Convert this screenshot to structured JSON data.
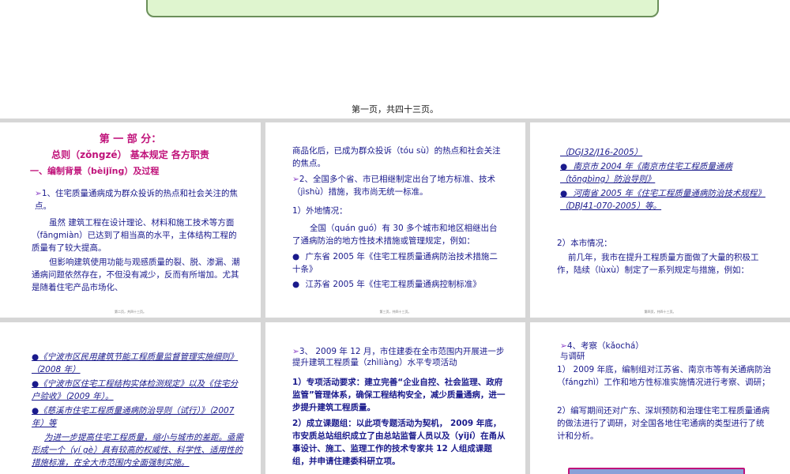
{
  "page_count": "第一页，共四十三页。",
  "slide1": {
    "heading": "第 一 部 分：",
    "subheading": "总则（zǒngzé） 基本规定 各方职责",
    "section": "一、编制背景（bèijǐng）及过程",
    "p1": "1、住宅质量通病成为群众投诉的热点和社会关注的焦点。",
    "p2": "虽然 建筑工程在设计理论、材料和施工技术等方面（fāngmiàn）已达到了相当高的水平，主体结构工程的质量有了较大提高。",
    "p3": "但影响建筑使用功能与观感质量的裂、脱、渗漏、潮通病问题依然存在，不但没有减少，反而有所增加。尤其是随着住宅产品市场化、",
    "footer": "第二页，共四十三页。"
  },
  "slide2": {
    "p1": "商品化后，已成为群众投诉（tóu sù）的热点和社会关注的焦点。",
    "p2": "2、全国多个省、市已相继制定出台了地方标准、技术（jìshù）措施，我市尚无统一标准。",
    "p3": "1）外地情况：",
    "p4": "全国（quán guó）有 30 多个城市和地区相继出台了通病防治的地方性技术措施或管理规定，例如：",
    "b1": "广东省 2005 年《住宅工程质量通病防治技术措施二十条》",
    "b2": "江苏省 2005 年《住宅工程质量通病控制标准》",
    "footer": "第三页，共四十三页。"
  },
  "slide3": {
    "l1": "（DGJ32/J16-2005）",
    "b1": "南京市 2004 年《南京市住宅工程质量通病（tōngbìng）防治导则》",
    "b2": "河南省 2005 年《住宅工程质量通病防治技术规程》（DBJ41-070-2005）等。",
    "p1": "2）本市情况：",
    "p2": "前几年，我市在提升工程质量方面做了大量的积极工作，陆续（lùxù）制定了一系列规定与措施，例如：",
    "footer": "第四页，共四十三页。"
  },
  "slide4": {
    "b1": "《宁波市区民用建筑节能工程质量监督管理实施细则》（2008 年）",
    "b2": "《宁波市区住宅工程结构实体检测规定》以及《住宅分户验收》（2009 年）。",
    "b3": "《慈溪市住宅工程质量通病防治导则（试行）》（2007 年）等",
    "p1": "为进一步提高住宅工程质量，缩小与城市的差距。亟需形成一个（yí gè）具有较高的权威性、科学性、适用性的措施标准，在全大市范围内全面强制实施。"
  },
  "slide5": {
    "p1": "3、 2009 年 12 月，市住建委在全市范围内开展进一步提升建筑工程质量（zhìliàng）水平专项活动",
    "p2": "1）专项活动要求：建立完善“企业自控、社会监理、政府监管”管理体系，确保工程结构安全，减少质量通病，进一步提升建筑工程质量。",
    "p3": "2）成立课题组：以此项专题活动为契机， 2009 年底，市安质总站组织成立了由总站监督人员以及（yǐjí）在甬从事设计、施工、监理工作的技术专家共 12 人组成课题组，并申请住建委科研立项。"
  },
  "slide6": {
    "p1": "4、考察（kǎochá）与调研",
    "p2": "1） 2009 年底，编制组对江苏省、南京市等有关通病防治（fángzhì）工作和地方性标准实施情况进行考察、调研；",
    "p3": "2）编写期间还对广东、深圳预防和治理住宅工程质量通病的做法进行了调研，对全国各地住宅通病的类型进行了统计和分析。"
  }
}
